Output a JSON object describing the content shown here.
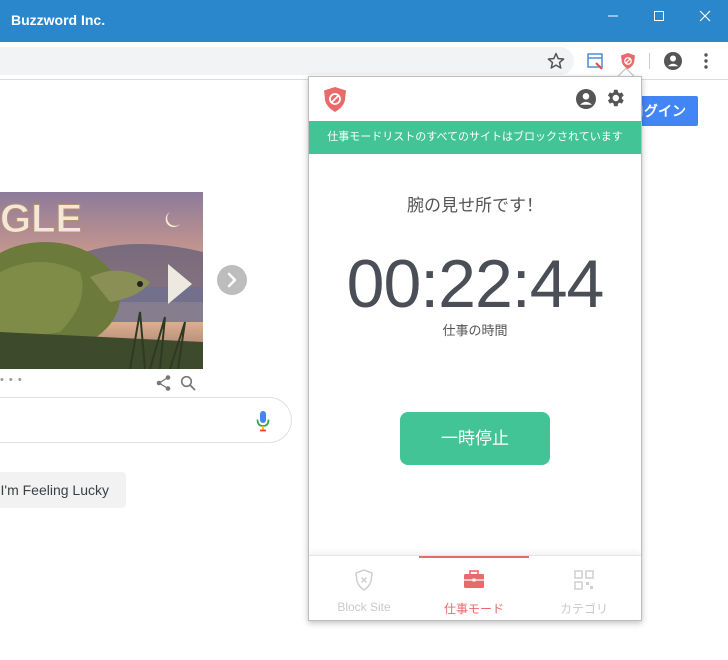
{
  "window": {
    "title": "Buzzword Inc."
  },
  "google": {
    "login_label": "ログイン",
    "lucky_label": "I'm Feeling Lucky",
    "doodle_dots": "• • •"
  },
  "popup": {
    "banner": "仕事モードリストのすべてのサイトはブロックされています",
    "message": "腕の見せ所です！",
    "timer": "00:22:44",
    "timer_label": "仕事の時間",
    "pause_label": "一時停止",
    "nav": [
      {
        "label": "Block Site",
        "icon": "shield-icon",
        "active": false
      },
      {
        "label": "仕事モード",
        "icon": "briefcase-icon",
        "active": true
      },
      {
        "label": "カテゴリ",
        "icon": "grid-icon",
        "active": false
      }
    ]
  },
  "colors": {
    "titlebar": "#2b87cc",
    "accent_green": "#43c496",
    "accent_red": "#e86a6a",
    "google_blue": "#4285f4"
  }
}
